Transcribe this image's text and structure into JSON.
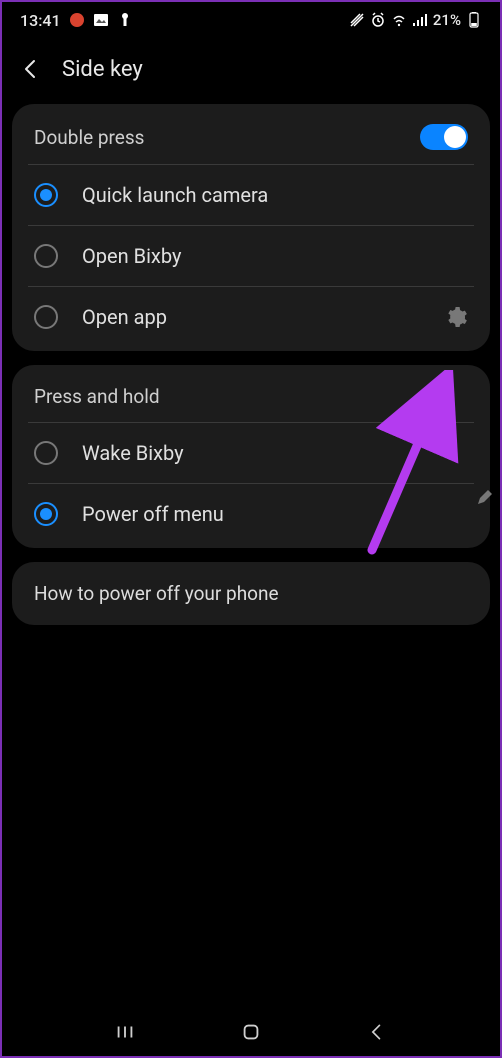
{
  "status": {
    "time": "13:41",
    "battery": "21%"
  },
  "header": {
    "title": "Side key"
  },
  "doublePress": {
    "title": "Double press",
    "toggle": true,
    "options": [
      {
        "label": "Quick launch camera",
        "checked": true,
        "gear": false
      },
      {
        "label": "Open Bixby",
        "checked": false,
        "gear": false
      },
      {
        "label": "Open app",
        "checked": false,
        "gear": true
      }
    ]
  },
  "pressHold": {
    "title": "Press and hold",
    "options": [
      {
        "label": "Wake Bixby",
        "checked": false
      },
      {
        "label": "Power off menu",
        "checked": true
      }
    ]
  },
  "info": {
    "text": "How to power off your phone"
  }
}
